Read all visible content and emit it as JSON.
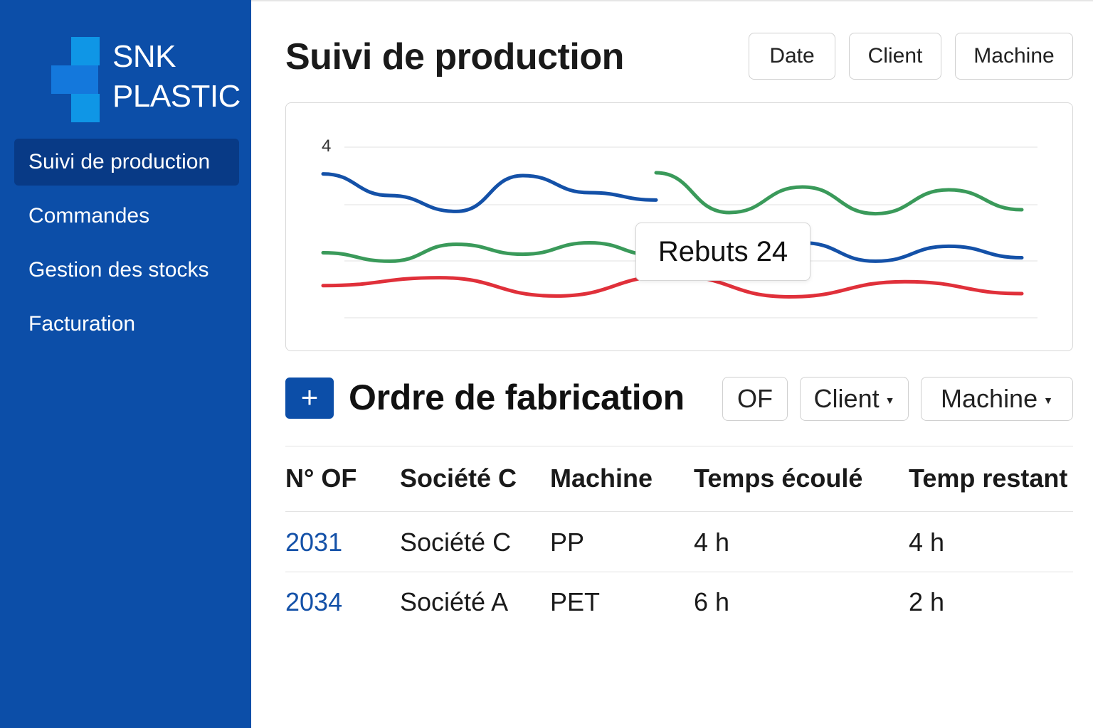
{
  "brand": {
    "line1": "SNK",
    "line2": "PLASTIC",
    "colors": {
      "sidebar": "#0c4ea8",
      "active": "#083a86",
      "mark_light": "#0f96e6",
      "mark_dark": "#1478dc"
    }
  },
  "sidebar": {
    "items": [
      {
        "label": "Suivi de production",
        "active": true
      },
      {
        "label": "Commandes",
        "active": false
      },
      {
        "label": "Gestion des stocks",
        "active": false
      },
      {
        "label": "Facturation",
        "active": false
      }
    ]
  },
  "header": {
    "title": "Suivi de production",
    "filters": [
      "Date",
      "Client",
      "Machine"
    ]
  },
  "chart_data": {
    "type": "line",
    "y_tick_labels": [
      "4"
    ],
    "grid": true,
    "series": [
      {
        "color": "#1451a8",
        "segments": [
          [
            0.22,
            0.6,
            0.88,
            0.25,
            0.55,
            0.68
          ],
          [
            0.4,
            0.7,
            0.35,
            0.72,
            0.42,
            0.65
          ]
        ]
      },
      {
        "color": "#3a9a5a",
        "segments": [
          [
            0.55,
            0.72,
            0.38,
            0.58,
            0.35,
            0.6
          ],
          [
            0.2,
            0.9,
            0.45,
            0.92,
            0.5,
            0.85
          ]
        ]
      },
      {
        "color": "#e0303a",
        "values": [
          0.3,
          0.1,
          0.56,
          0.05,
          0.58,
          0.2,
          0.5
        ]
      }
    ],
    "tooltip": {
      "label": "Rebuts 24"
    }
  },
  "section": {
    "title": "Ordre de fabrication",
    "add_label": "+",
    "filters": [
      {
        "label": "OF",
        "dropdown": false
      },
      {
        "label": "Client",
        "dropdown": true
      },
      {
        "label": "Machine",
        "dropdown": true
      }
    ]
  },
  "table": {
    "columns": [
      "N° OF",
      "Société C",
      "Machine",
      "Temps écoulé",
      "Temp restant"
    ],
    "rows": [
      {
        "of": "2031",
        "societe": "Société C",
        "machine": "PP",
        "ecoule": "4 h",
        "restant": "4 h"
      },
      {
        "of": "2034",
        "societe": "Société A",
        "machine": "PET",
        "ecoule": "6 h",
        "restant": "2 h"
      }
    ]
  }
}
